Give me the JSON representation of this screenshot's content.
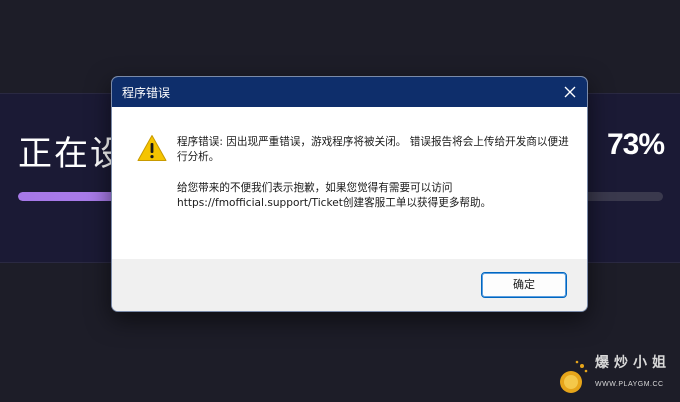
{
  "background": {
    "installing_text": "正在设",
    "percent_text": "73%",
    "progress": 0.73,
    "accent_color": "#a678e8"
  },
  "dialog": {
    "title": "程序错误",
    "close_icon": "close-icon",
    "warning_icon": "warning-icon",
    "message_line1": "程序错误: 因出现严重错误，游戏程序将被关闭。 错误报告将会上传给开发商以便进行分析。",
    "message_line2": "给您带来的不便我们表示抱歉，如果您觉得有需要可以访问 https://fmofficial.support/Ticket创建客服工单以获得更多帮助。",
    "ok_label": "确定",
    "titlebar_color": "#0e2e6b"
  },
  "watermark": {
    "text": "爆炒小姐",
    "sub": "WWW.PLAYGM.CC"
  }
}
